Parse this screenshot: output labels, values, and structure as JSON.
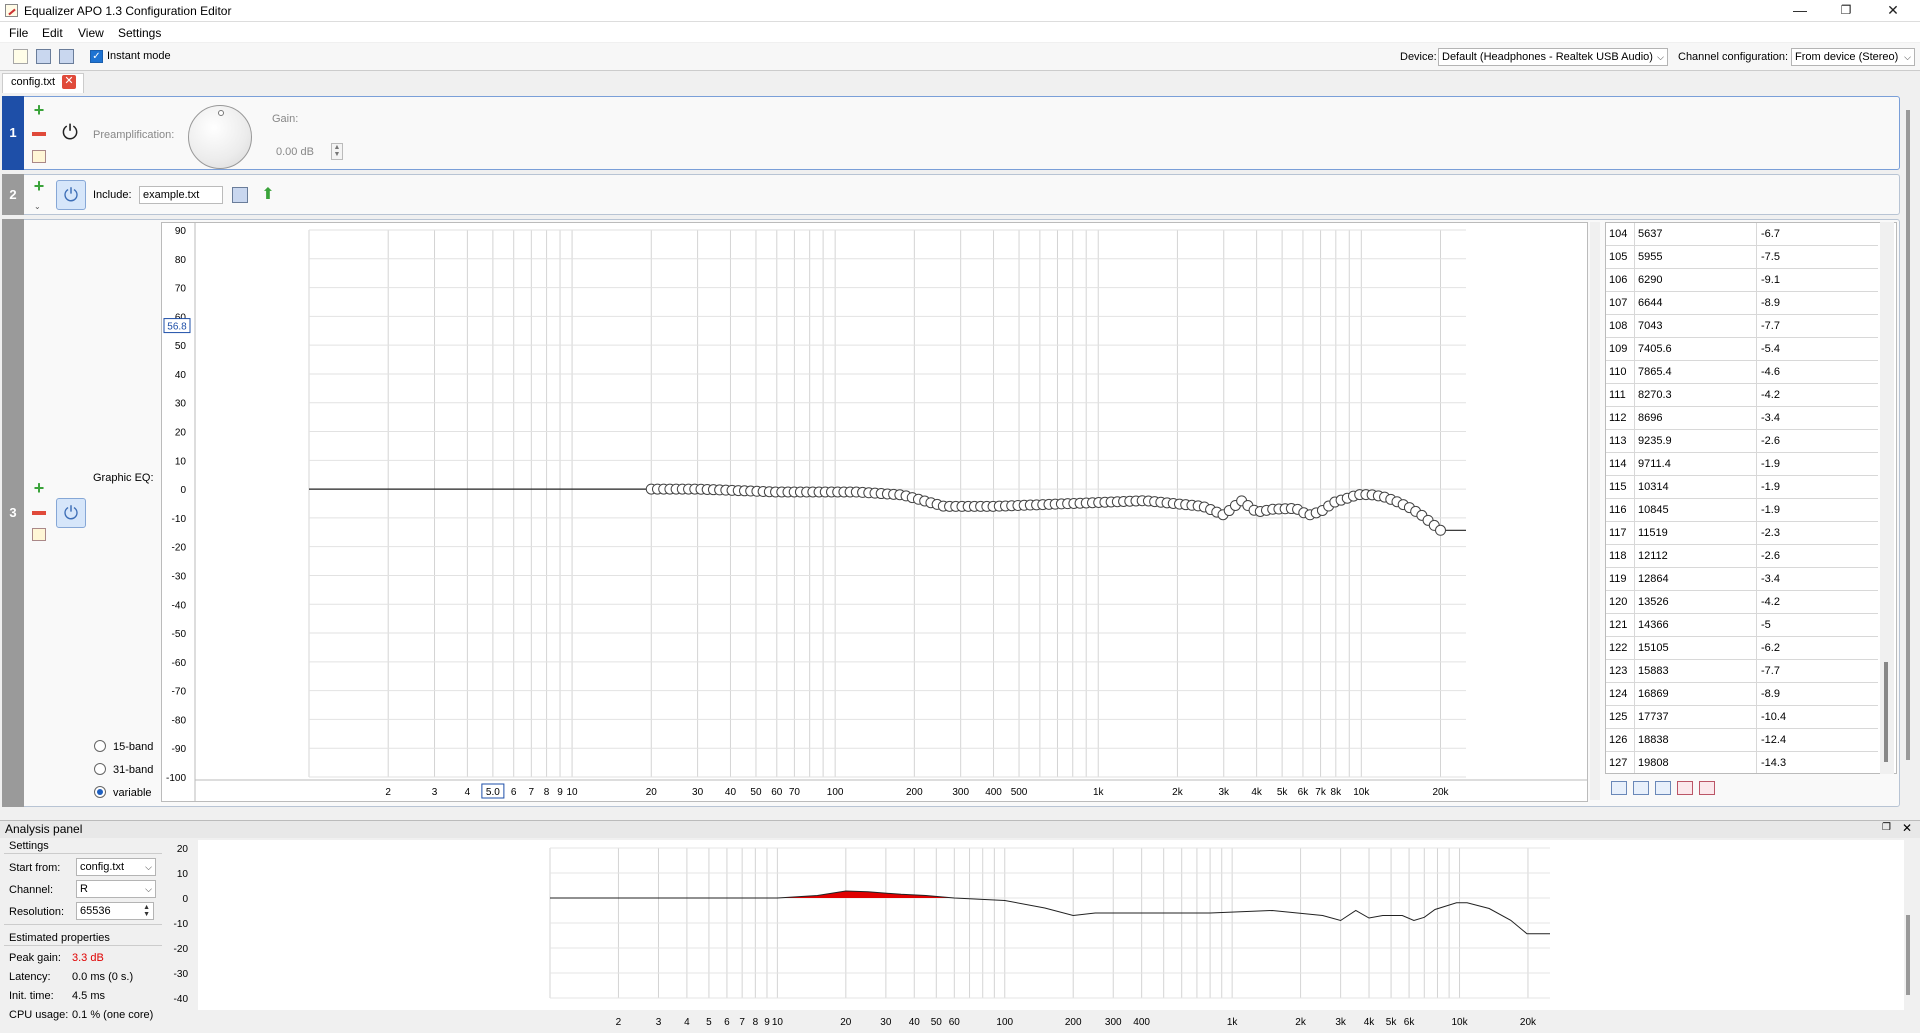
{
  "window": {
    "title": "Equalizer APO 1.3 Configuration Editor",
    "minimize": "—",
    "restore": "❐",
    "close": "✕"
  },
  "menu": [
    "File",
    "Edit",
    "View",
    "Settings"
  ],
  "toolbar": {
    "instant_mode_label": "Instant mode",
    "instant_mode_checked": true,
    "device_label": "Device:",
    "device_value": "Default (Headphones - Realtek USB Audio)",
    "channel_config_label": "Channel configuration:",
    "channel_config_value": "From device (Stereo)"
  },
  "tabs": [
    {
      "label": "config.txt",
      "close": "✕"
    }
  ],
  "filters": [
    {
      "number": "1",
      "preamp_label": "Preamplification:",
      "gain_label": "Gain:",
      "gain_value": "0.00 dB"
    },
    {
      "number": "2",
      "include_label": "Include:",
      "include_value": "example.txt"
    },
    {
      "number": "3",
      "graphic_eq_label": "Graphic EQ:",
      "band_options": [
        "15-band",
        "31-band",
        "variable"
      ],
      "band_selected": "variable",
      "y_ticks": [
        "90",
        "80",
        "70",
        "60",
        "50",
        "40",
        "30",
        "20",
        "10",
        "0",
        "-10",
        "-20",
        "-30",
        "-40",
        "-50",
        "-60",
        "-70",
        "-80",
        "-90",
        "-100"
      ],
      "x_ticks": [
        "2",
        "3",
        "4",
        "5.0",
        "6",
        "7",
        "8",
        "9",
        "10",
        "20",
        "30",
        "40",
        "50",
        "60",
        "70",
        "100",
        "200",
        "300",
        "400",
        "500",
        "1k",
        "2k",
        "3k",
        "4k",
        "5k",
        "6k",
        "7k",
        "8k",
        "10k",
        "20k"
      ],
      "y_marker": "56.8",
      "table": [
        {
          "index": "104",
          "freq": "5637",
          "gain": "-6.7"
        },
        {
          "index": "105",
          "freq": "5955",
          "gain": "-7.5"
        },
        {
          "index": "106",
          "freq": "6290",
          "gain": "-9.1"
        },
        {
          "index": "107",
          "freq": "6644",
          "gain": "-8.9"
        },
        {
          "index": "108",
          "freq": "7043",
          "gain": "-7.7"
        },
        {
          "index": "109",
          "freq": "7405.6",
          "gain": "-5.4"
        },
        {
          "index": "110",
          "freq": "7865.4",
          "gain": "-4.6"
        },
        {
          "index": "111",
          "freq": "8270.3",
          "gain": "-4.2"
        },
        {
          "index": "112",
          "freq": "8696",
          "gain": "-3.4"
        },
        {
          "index": "113",
          "freq": "9235.9",
          "gain": "-2.6"
        },
        {
          "index": "114",
          "freq": "9711.4",
          "gain": "-1.9"
        },
        {
          "index": "115",
          "freq": "10314",
          "gain": "-1.9"
        },
        {
          "index": "116",
          "freq": "10845",
          "gain": "-1.9"
        },
        {
          "index": "117",
          "freq": "11519",
          "gain": "-2.3"
        },
        {
          "index": "118",
          "freq": "12112",
          "gain": "-2.6"
        },
        {
          "index": "119",
          "freq": "12864",
          "gain": "-3.4"
        },
        {
          "index": "120",
          "freq": "13526",
          "gain": "-4.2"
        },
        {
          "index": "121",
          "freq": "14366",
          "gain": "-5"
        },
        {
          "index": "122",
          "freq": "15105",
          "gain": "-6.2"
        },
        {
          "index": "123",
          "freq": "15883",
          "gain": "-7.7"
        },
        {
          "index": "124",
          "freq": "16869",
          "gain": "-8.9"
        },
        {
          "index": "125",
          "freq": "17737",
          "gain": "-10.4"
        },
        {
          "index": "126",
          "freq": "18838",
          "gain": "-12.4"
        },
        {
          "index": "127",
          "freq": "19808",
          "gain": "-14.3"
        }
      ]
    }
  ],
  "analysis": {
    "title": "Analysis panel",
    "settings_label": "Settings",
    "start_from_label": "Start from:",
    "start_from_value": "config.txt",
    "channel_label": "Channel:",
    "channel_value": "R",
    "resolution_label": "Resolution:",
    "resolution_value": "65536",
    "estimated_label": "Estimated properties",
    "peak_gain_label": "Peak gain:",
    "peak_gain_value": "3.3 dB",
    "latency_label": "Latency:",
    "latency_value": "0.0 ms (0 s.)",
    "init_time_label": "Init. time:",
    "init_time_value": "4.5 ms",
    "cpu_label": "CPU usage:",
    "cpu_value": "0.1 % (one core)",
    "y_ticks": [
      "20",
      "10",
      "0",
      "-10",
      "-20",
      "-30",
      "-40"
    ],
    "x_ticks": [
      "2",
      "3",
      "4",
      "5",
      "6",
      "7",
      "8",
      "9",
      "10",
      "20",
      "30",
      "40",
      "50",
      "60",
      "100",
      "200",
      "300",
      "400",
      "1k",
      "2k",
      "3k",
      "4k",
      "5k",
      "6k",
      "10k",
      "20k"
    ]
  },
  "colors": {
    "accent": "#1e4fa8",
    "peak": "#e00000",
    "block3": "#9a9a9a"
  }
}
